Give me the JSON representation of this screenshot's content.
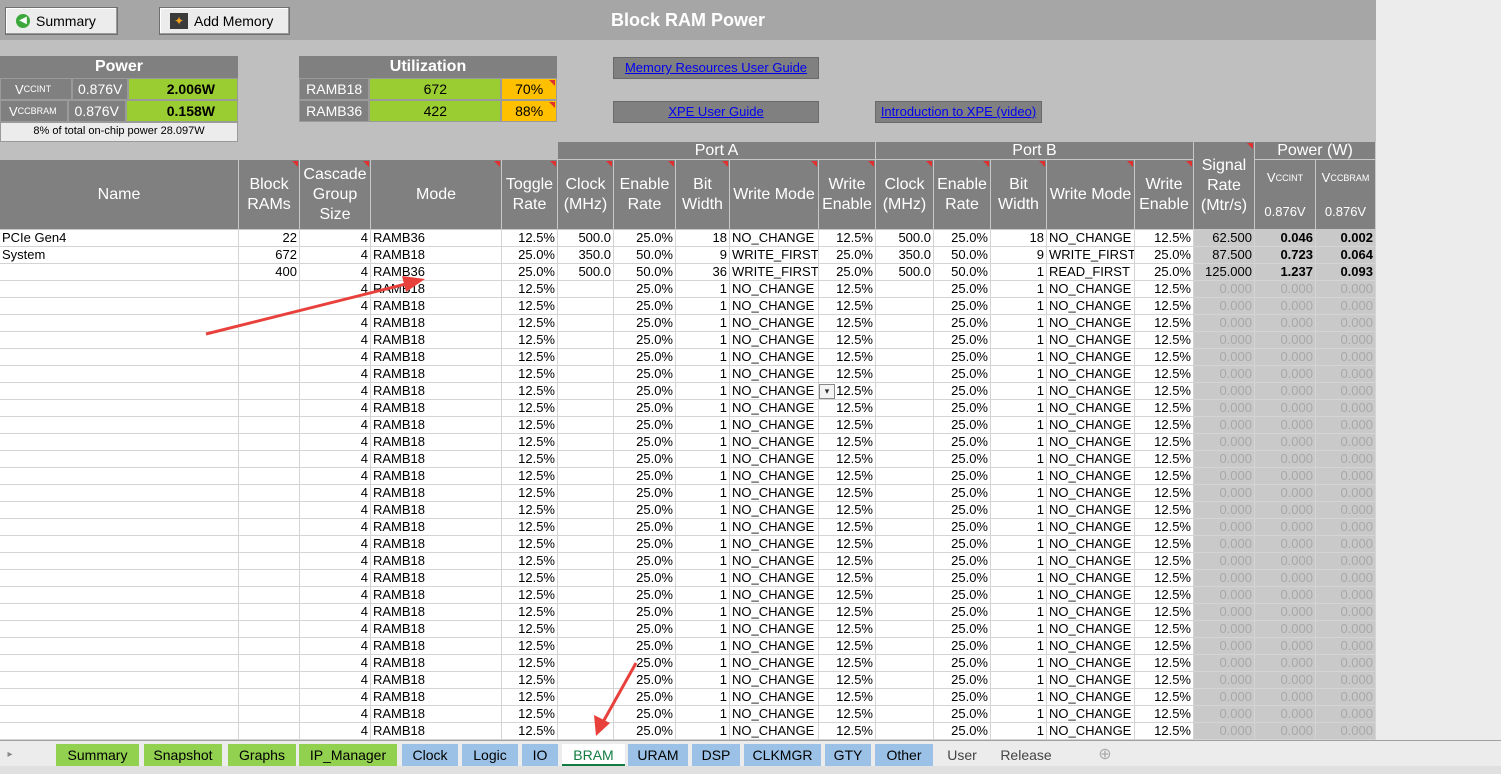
{
  "header": {
    "title": "Block RAM Power",
    "summary_button": "Summary",
    "add_memory_button": "Add Memory"
  },
  "power": {
    "title": "Power",
    "rows": [
      {
        "rail": "VCCINT",
        "voltage": "0.876V",
        "power": "2.006W"
      },
      {
        "rail": "VCCBRAM",
        "voltage": "0.876V",
        "power": "0.158W"
      }
    ],
    "note": "8% of total on-chip power 28.097W"
  },
  "utilization": {
    "title": "Utilization",
    "rows": [
      {
        "name": "RAMB18",
        "count": "672",
        "pct": "70%"
      },
      {
        "name": "RAMB36",
        "count": "422",
        "pct": "88%"
      }
    ]
  },
  "links": {
    "memory_guide": "Memory Resources User Guide",
    "xpe_guide": "XPE User Guide",
    "intro_video": "Introduction to XPE (video)"
  },
  "table_headers": {
    "name": "Name",
    "block_rams": "Block RAMs",
    "cascade": "Cascade Group Size",
    "mode": "Mode",
    "toggle": "Toggle Rate",
    "port_a": "Port A",
    "port_b": "Port B",
    "clock": "Clock (MHz)",
    "enable": "Enable Rate",
    "bit_width": "Bit Width",
    "write_mode": "Write Mode",
    "write_enable": "Write Enable",
    "signal_rate": "Signal Rate (Mtr/s)",
    "power_w": "Power (W)",
    "vccint": "VCCINT",
    "vccbram": "VCCBRAM",
    "vccint_v": "0.876V",
    "vccbram_v": "0.876V"
  },
  "rows": [
    [
      "PCIe Gen4",
      "22",
      "4",
      "RAMB36",
      "12.5%",
      "500.0",
      "25.0%",
      "18",
      "NO_CHANGE",
      "12.5%",
      "500.0",
      "25.0%",
      "18",
      "NO_CHANGE",
      "12.5%",
      "62.500",
      "0.046",
      "0.002"
    ],
    [
      "System",
      "672",
      "4",
      "RAMB18",
      "25.0%",
      "350.0",
      "50.0%",
      "9",
      "WRITE_FIRST",
      "25.0%",
      "350.0",
      "50.0%",
      "9",
      "WRITE_FIRST",
      "25.0%",
      "87.500",
      "0.723",
      "0.064"
    ],
    [
      "",
      "400",
      "4",
      "RAMB36",
      "25.0%",
      "500.0",
      "50.0%",
      "36",
      "WRITE_FIRST",
      "25.0%",
      "500.0",
      "50.0%",
      "1",
      "READ_FIRST",
      "25.0%",
      "125.000",
      "1.237",
      "0.093"
    ]
  ],
  "default_row": [
    "",
    "",
    "4",
    "RAMB18",
    "12.5%",
    "",
    "25.0%",
    "1",
    "NO_CHANGE",
    "12.5%",
    "",
    "25.0%",
    "1",
    "NO_CHANGE",
    "12.5%",
    "0.000",
    "0.000",
    "0.000"
  ],
  "default_row_count": 27,
  "tabs": [
    {
      "label": "Summary",
      "style": "g"
    },
    {
      "label": "Snapshot",
      "style": "g"
    },
    {
      "label": "Graphs",
      "style": "g"
    },
    {
      "label": "IP_Manager",
      "style": "g"
    },
    {
      "label": "Clock",
      "style": "b"
    },
    {
      "label": "Logic",
      "style": "b"
    },
    {
      "label": "IO",
      "style": "b"
    },
    {
      "label": "BRAM",
      "style": "act"
    },
    {
      "label": "URAM",
      "style": "b"
    },
    {
      "label": "DSP",
      "style": "b"
    },
    {
      "label": "CLKMGR",
      "style": "b"
    },
    {
      "label": "GTY",
      "style": "b"
    },
    {
      "label": "Other",
      "style": "b"
    },
    {
      "label": "User",
      "style": "p"
    },
    {
      "label": "Release",
      "style": "p"
    }
  ],
  "colors": {
    "accent_green": "#9acd32",
    "warning": "#ffc000",
    "header_gray": "#808080",
    "arrow": "#e8413c"
  }
}
